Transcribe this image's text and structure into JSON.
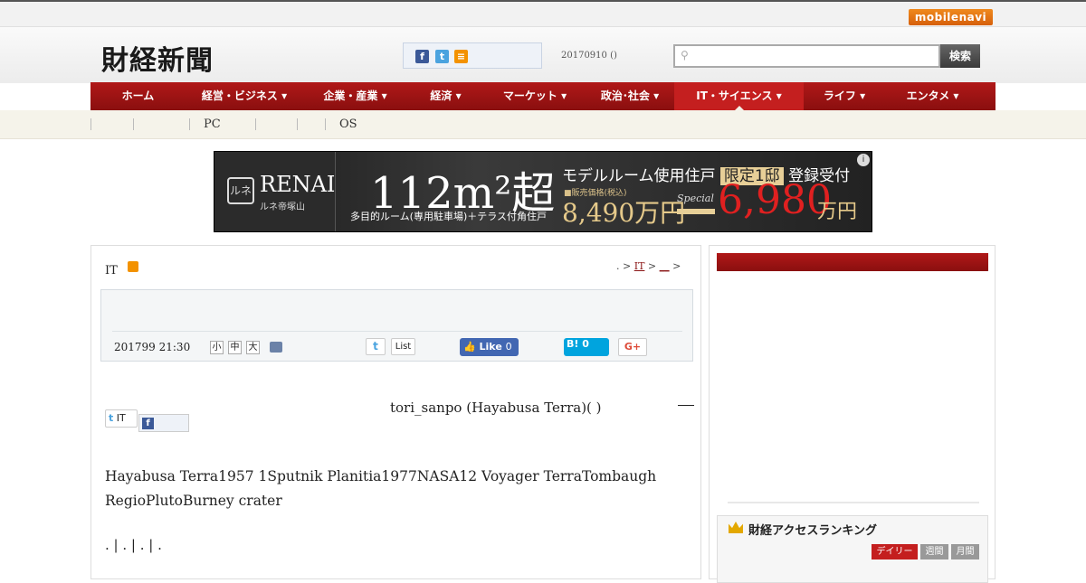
{
  "topbar": {
    "mobile_label": "mobilenavi"
  },
  "header": {
    "logo": "財経新聞",
    "date": "20170910 ()",
    "search_placeholder": "",
    "search_button": "検索"
  },
  "nav": {
    "items": [
      {
        "label": "ホーム"
      },
      {
        "label": "経営・ビジネス ▾"
      },
      {
        "label": "企業・産業 ▾"
      },
      {
        "label": "経済 ▾"
      },
      {
        "label": "マーケット ▾"
      },
      {
        "label": "政治･社会 ▾"
      },
      {
        "label": "IT・サイエンス ▾"
      },
      {
        "label": "ライフ ▾"
      },
      {
        "label": "エンタメ ▾"
      }
    ]
  },
  "subnav": {
    "items": [
      "PC",
      "OS"
    ]
  },
  "ad": {
    "brand": "RENAI",
    "brand_sub": "ルネ帝塚山",
    "headline": "112m²超",
    "headline_sub": "多目的ルーム(専用駐車場)＋テラス付角住戸",
    "offer": "モデルルーム使用住戸",
    "badge": "限定1邸",
    "offer_tail": "登録受付",
    "old_price_label": "■販売価格(税込)",
    "old_price": "8,490万円",
    "special": "Special",
    "new_price": "6,980",
    "unit": "万円"
  },
  "article": {
    "category": "IT",
    "breadcrumb_prefix": ". >",
    "breadcrumb_it": "IT",
    "breadcrumb_sep": ">",
    "breadcrumb_last": "__",
    "breadcrumb_end": ">",
    "pub_date": "201799 21:30",
    "font_sizes": [
      "小",
      "中",
      "大"
    ],
    "list_label": "List",
    "like_label": "Like",
    "like_count": "0",
    "hatena_label": "B! 0",
    "gplus_label": "G+",
    "share_tw_label": "IT",
    "caption": "tori_sanpo  (Hayabusa Terra)(  )",
    "body": "Hayabusa Terra1957 1Sputnik Planitia1977NASA12 Voyager TerraTombaugh RegioPlutoBurney crater",
    "tail": ". | . | . | ."
  },
  "sidebar": {
    "ranking_title": "財経アクセスランキング",
    "tabs": [
      "デイリー",
      "週間",
      "月間"
    ]
  },
  "colors": {
    "brand_red": "#8a0f0f",
    "accent_orange": "#f39200"
  }
}
